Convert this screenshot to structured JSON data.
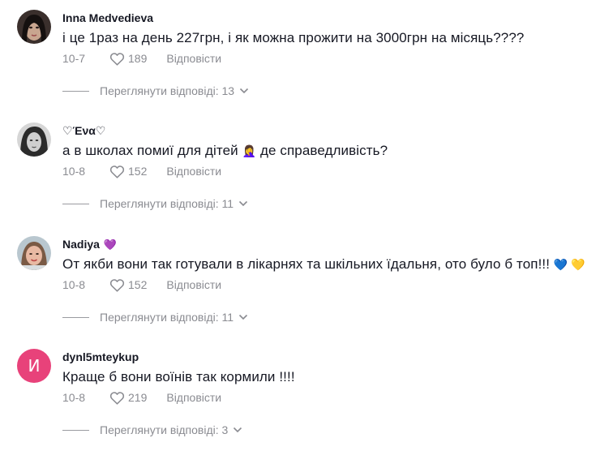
{
  "comments": [
    {
      "username": "Inna Medvedieva",
      "badge": "",
      "text": "і це 1раз на день 227грн, і як можна прожити на 3000грн на місяць????",
      "date": "10-7",
      "likes": "189",
      "reply_label": "Відповісти",
      "view_replies": "Переглянути відповіді: 13"
    },
    {
      "username": "♡Ένα♡",
      "badge": "",
      "text_before": "а в школах помиї для дітей",
      "emoji": "🤦‍♀️",
      "text_after": "де справедливість?",
      "date": "10-8",
      "likes": "152",
      "reply_label": "Відповісти",
      "view_replies": "Переглянути відповіді: 11"
    },
    {
      "username": "Nadiya",
      "badge": "💜",
      "text": "От якби вони так готували в лікарнях та шкільних їдальня, ото було б топ!!!",
      "emoji_end": "💙 💛",
      "date": "10-8",
      "likes": "152",
      "reply_label": "Відповісти",
      "view_replies": "Переглянути відповіді: 11"
    },
    {
      "username": "dynl5mteykup",
      "badge": "",
      "avatar_letter": "И",
      "text": "Краще б вони воїнів так кормили !!!!",
      "date": "10-8",
      "likes": "219",
      "reply_label": "Відповісти",
      "view_replies": "Переглянути відповіді: 3"
    }
  ],
  "colors": {
    "text": "#161823",
    "muted": "#8a8b91",
    "avatar_letter_bg": "#e8427a"
  },
  "icons": [
    "heart-icon",
    "chevron-down-icon"
  ]
}
